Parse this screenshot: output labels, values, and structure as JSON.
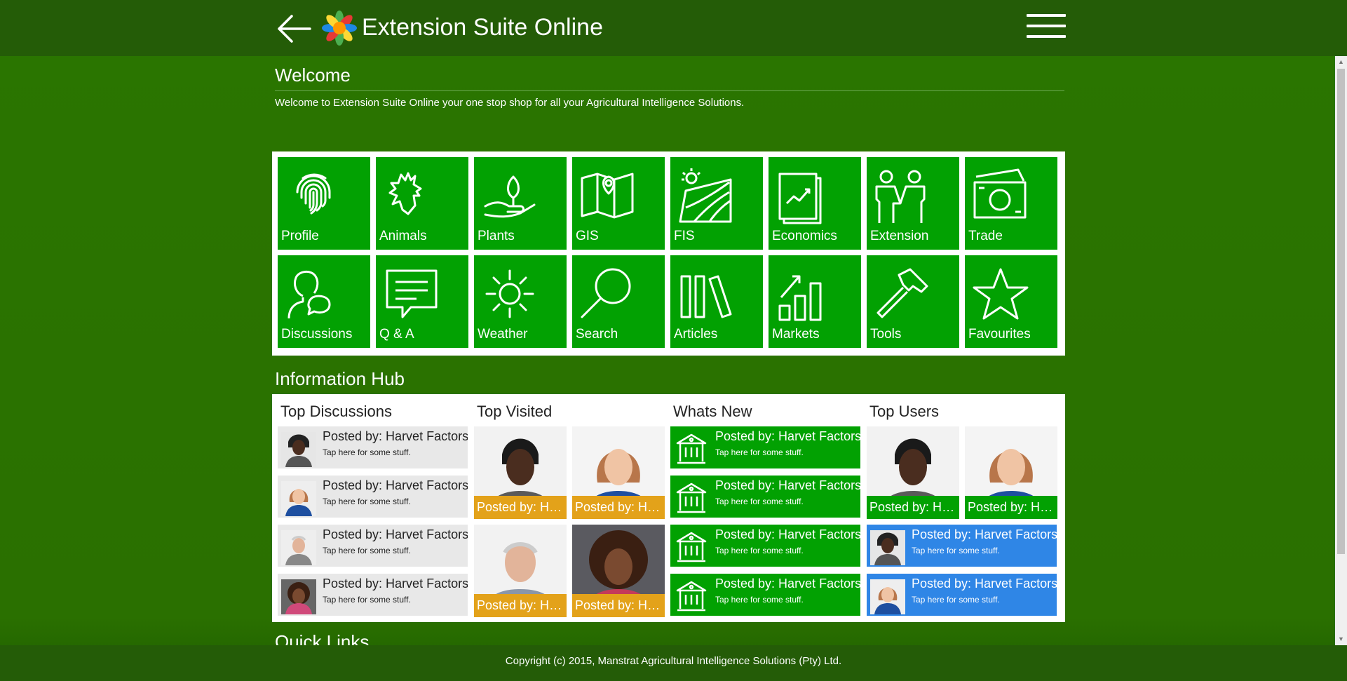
{
  "header": {
    "title": "Extension Suite Online",
    "back_icon": "arrow-left-icon",
    "menu_icon": "hamburger-menu-icon",
    "logo_icon": "flower-logo-icon"
  },
  "welcome": {
    "title": "Welcome",
    "text": "Welcome to Extension Suite Online your one stop shop for all your Agricultural Intelligence Solutions."
  },
  "tiles": [
    {
      "label": "Profile",
      "icon": "fingerprint-icon"
    },
    {
      "label": "Animals",
      "icon": "rooster-icon"
    },
    {
      "label": "Plants",
      "icon": "plant-hand-icon"
    },
    {
      "label": "GIS",
      "icon": "map-pin-icon"
    },
    {
      "label": "FIS",
      "icon": "field-sun-icon"
    },
    {
      "label": "Economics",
      "icon": "chart-document-icon"
    },
    {
      "label": "Extension",
      "icon": "handshake-people-icon"
    },
    {
      "label": "Trade",
      "icon": "money-icon"
    },
    {
      "label": "Discussions",
      "icon": "person-speech-icon"
    },
    {
      "label": "Q & A",
      "icon": "chat-bubble-icon"
    },
    {
      "label": "Weather",
      "icon": "sun-icon"
    },
    {
      "label": "Search",
      "icon": "magnifier-icon"
    },
    {
      "label": "Articles",
      "icon": "books-icon"
    },
    {
      "label": "Markets",
      "icon": "bar-growth-icon"
    },
    {
      "label": "Tools",
      "icon": "hammer-icon"
    },
    {
      "label": "Favourites",
      "icon": "star-icon"
    }
  ],
  "hub": {
    "title": "Information Hub",
    "top_discussions": {
      "title": "Top Discussions",
      "items": [
        {
          "title": "Posted by: Harvet Factors",
          "sub": "Tap here for some stuff."
        },
        {
          "title": "Posted by: Harvet Factors",
          "sub": "Tap here for some stuff."
        },
        {
          "title": "Posted by: Harvet Factors",
          "sub": "Tap here for some stuff."
        },
        {
          "title": "Posted by: Harvet Factors",
          "sub": "Tap here for some stuff."
        }
      ]
    },
    "top_visited": {
      "title": "Top Visited",
      "items": [
        {
          "caption": "Posted by: Harvet Factors"
        },
        {
          "caption": "Posted by: Harvet Factors"
        },
        {
          "caption": "Posted by: Harvet Factors"
        },
        {
          "caption": "Posted by: Harvet Factors"
        }
      ]
    },
    "whats_new": {
      "title": "Whats New",
      "items": [
        {
          "title": "Posted by: Harvet Factors",
          "sub": "Tap here for some stuff."
        },
        {
          "title": "Posted by: Harvet Factors",
          "sub": "Tap here for some stuff."
        },
        {
          "title": "Posted by: Harvet Factors",
          "sub": "Tap here for some stuff."
        },
        {
          "title": "Posted by: Harvet Factors",
          "sub": "Tap here for some stuff."
        }
      ]
    },
    "top_users": {
      "title": "Top Users",
      "photos": [
        {
          "caption": "Posted by: Harvet Factors"
        },
        {
          "caption": "Posted by: Harvet Factors"
        }
      ],
      "items": [
        {
          "title": "Posted by: Harvet Factors",
          "sub": "Tap here for some stuff."
        },
        {
          "title": "Posted by: Harvet Factors",
          "sub": "Tap here for some stuff."
        }
      ]
    }
  },
  "quick_links": {
    "title": "Quick Links"
  },
  "footer": {
    "text": "Copyright (c) 2015, Manstrat Agricultural Intelligence Solutions (Pty) Ltd."
  },
  "colors": {
    "header": "#245c07",
    "background": "#2a7000",
    "tile": "#02a102",
    "caption_orange": "#e3a21a",
    "user_blue": "#2f86e6"
  }
}
